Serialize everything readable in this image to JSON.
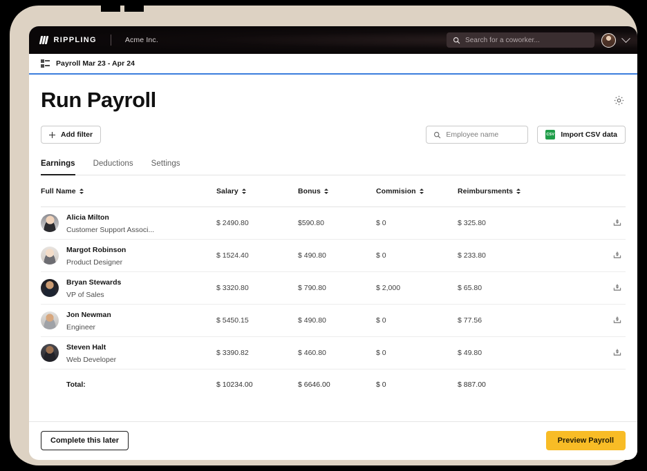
{
  "topbar": {
    "brand_name": "RIPPLING",
    "company": "Acme Inc.",
    "search_placeholder": "Search for a coworker...",
    "search_icon": "search-icon",
    "avatar_icon": "user-avatar",
    "chevron_icon": "chevron-down-icon"
  },
  "breadcrumb": {
    "icon": "payroll-list-icon",
    "label": "Payroll Mar 23 - Apr 24",
    "accent_color": "#3b7ddd"
  },
  "page": {
    "title": "Run Payroll",
    "settings_icon": "gear-icon"
  },
  "toolbar": {
    "add_filter_label": "Add filter",
    "add_filter_icon": "plus-icon",
    "employee_search_placeholder": "Employee name",
    "employee_search_value": "",
    "employee_search_icon": "search-icon",
    "import_csv_label": "Import CSV data",
    "import_csv_icon": "csv-file-icon",
    "csv_icon_text": "CSV",
    "csv_icon_color": "#1f9d49"
  },
  "tabs": [
    {
      "label": "Earnings",
      "active": true
    },
    {
      "label": "Deductions",
      "active": false
    },
    {
      "label": "Settings",
      "active": false
    }
  ],
  "table": {
    "columns": [
      {
        "label": "Full Name",
        "sortable": true
      },
      {
        "label": "Salary",
        "sortable": true
      },
      {
        "label": "Bonus",
        "sortable": true
      },
      {
        "label": "Commision",
        "sortable": true
      },
      {
        "label": "Reimbursments",
        "sortable": true
      }
    ],
    "rows": [
      {
        "name": "Alicia Milton",
        "role": "Customer Support Associ...",
        "salary": "$ 2490.80",
        "bonus": "$590.80",
        "commision": "$ 0",
        "reimbursments": "$ 325.80",
        "action_icon": "money-deposit-icon"
      },
      {
        "name": "Margot Robinson",
        "role": "Product Designer",
        "salary": "$ 1524.40",
        "bonus": "$ 490.80",
        "commision": "$ 0",
        "reimbursments": "$ 233.80",
        "action_icon": "money-deposit-icon"
      },
      {
        "name": "Bryan Stewards",
        "role": "VP of Sales",
        "salary": "$ 3320.80",
        "bonus": "$ 790.80",
        "commision": "$ 2,000",
        "reimbursments": "$ 65.80",
        "action_icon": "money-deposit-icon"
      },
      {
        "name": "Jon Newman",
        "role": "Engineer",
        "salary": "$ 5450.15",
        "bonus": "$ 490.80",
        "commision": "$ 0",
        "reimbursments": "$ 77.56",
        "action_icon": "money-deposit-icon"
      },
      {
        "name": "Steven Halt",
        "role": "Web Developer",
        "salary": "$ 3390.82",
        "bonus": "$ 460.80",
        "commision": "$ 0",
        "reimbursments": "$ 49.80",
        "action_icon": "money-deposit-icon"
      }
    ],
    "total": {
      "label": "Total:",
      "salary": "$ 10234.00",
      "bonus": "$ 6646.00",
      "commision": "$ 0",
      "reimbursments": "$ 887.00"
    }
  },
  "footer": {
    "later_label": "Complete this later",
    "preview_label": "Preview Payroll",
    "preview_color": "#f8bc26"
  }
}
